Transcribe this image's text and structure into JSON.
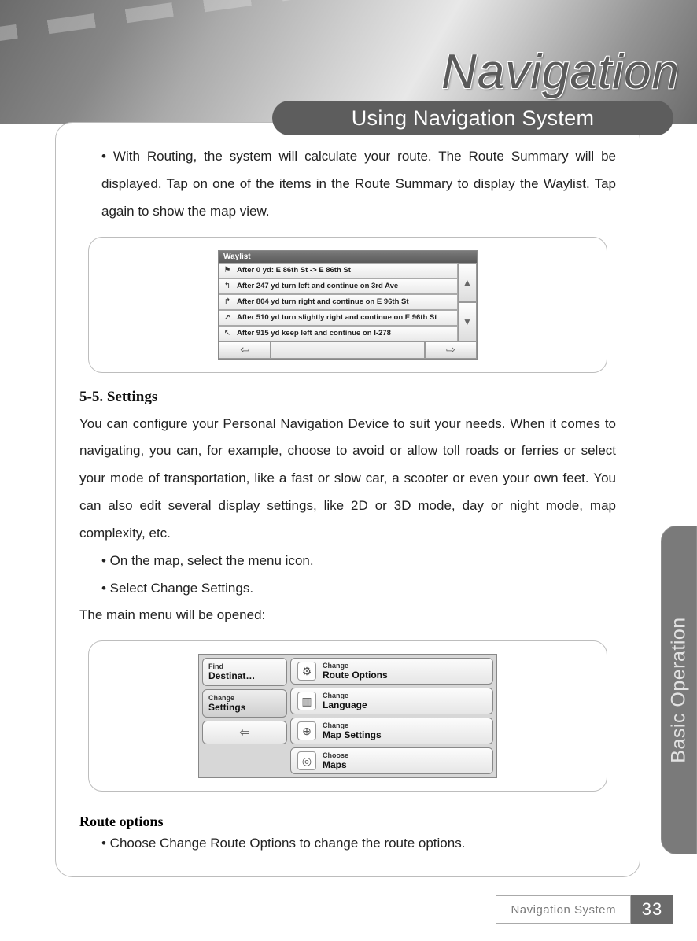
{
  "hero": {
    "title": "Navigation",
    "chapter": "Using Navigation System"
  },
  "intro_bullet": "• With Routing, the system will calculate your route. The Route Summary will be displayed. Tap on one of the items in the Route Summary to display the Waylist. Tap again to show the map view.",
  "waylist": {
    "title": "Waylist",
    "rows": [
      "After 0 yd: E 86th St -> E 86th St",
      "After 247 yd turn left and continue on 3rd Ave",
      "After 804 yd turn right and continue on E 96th St",
      "After 510 yd turn slightly right and continue on E 96th St",
      "After 915 yd keep left and continue on I-278"
    ],
    "up_icon": "▲",
    "down_icon": "▼",
    "back_icon": "⇦",
    "fwd_icon": "⇨"
  },
  "section": {
    "heading": "5-5. Settings",
    "para": "You can configure your Personal Navigation Device to suit your needs. When it comes to navigating, you can, for example, choose to avoid or allow toll roads or ferries or select your mode of transportation, like a fast or slow car, a scooter or even your own feet. You can also edit several display settings, like 2D or 3D mode, day or night mode, map complexity, etc.",
    "bullet1": "• On the map, select the menu icon.",
    "bullet2": "• Select Change Settings.",
    "closing": "The main menu will be opened:"
  },
  "settings_menu": {
    "left": {
      "find_small": "Find",
      "find_big": "Destinat…",
      "change_small": "Change",
      "change_big": "Settings",
      "back_icon": "⇦"
    },
    "items": [
      {
        "icon": "⚙",
        "small": "Change",
        "big": "Route Options"
      },
      {
        "icon": "▥",
        "small": "Change",
        "big": "Language"
      },
      {
        "icon": "⊕",
        "small": "Change",
        "big": "Map Settings"
      },
      {
        "icon": "◎",
        "small": "Choose",
        "big": "Maps"
      }
    ]
  },
  "route_options": {
    "heading": "Route options",
    "bullet": "• Choose Change Route Options to change the route options."
  },
  "side_tab": "Basic Operation",
  "footer": {
    "book": "Navigation System",
    "page": "33"
  }
}
